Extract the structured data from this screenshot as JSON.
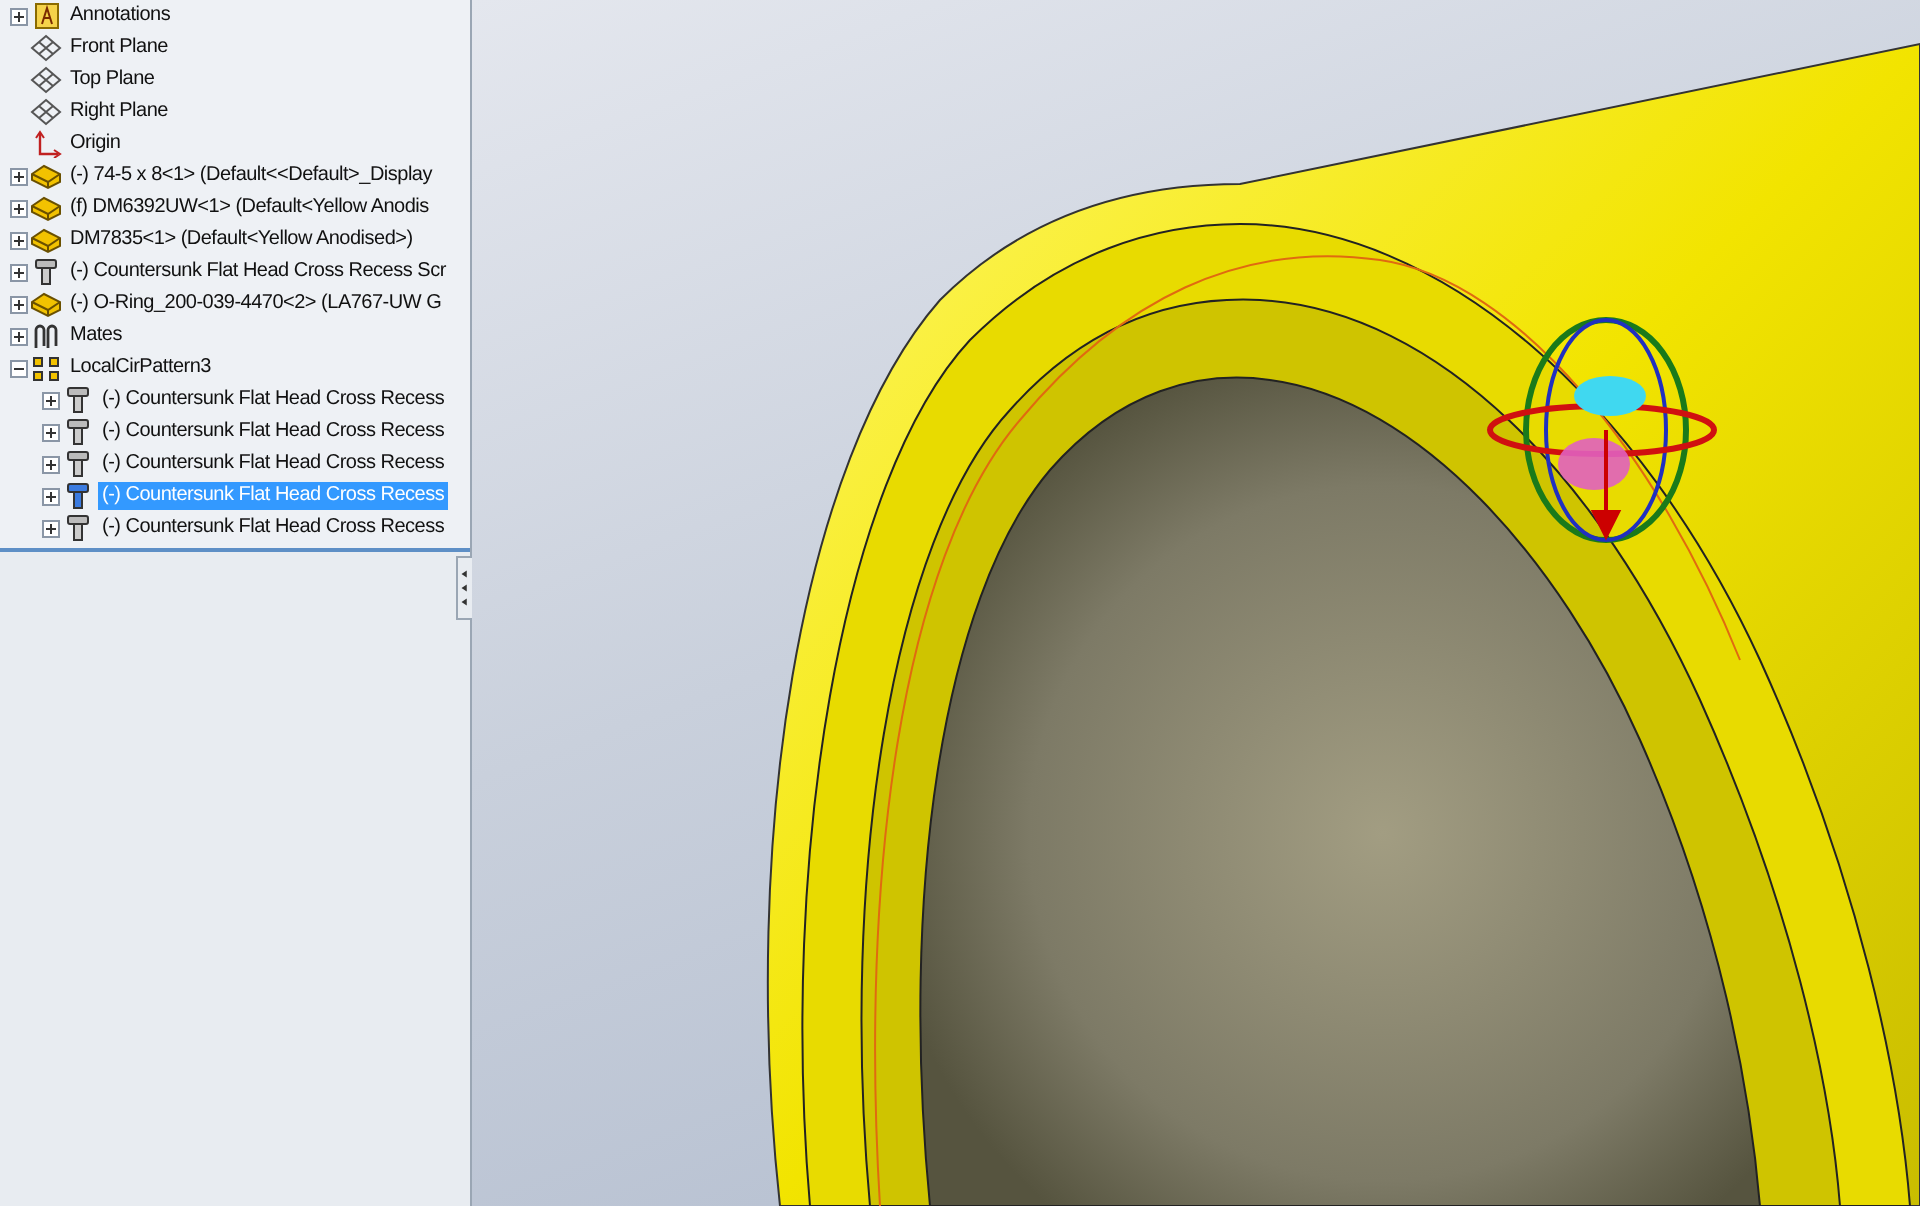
{
  "tree": [
    {
      "kind": "annotations",
      "label": "Annotations",
      "expanded": false,
      "selected": false
    },
    {
      "kind": "plane",
      "label": "Front Plane",
      "selected": false
    },
    {
      "kind": "plane",
      "label": "Top Plane",
      "selected": false
    },
    {
      "kind": "plane",
      "label": "Right Plane",
      "selected": false
    },
    {
      "kind": "origin",
      "label": "Origin",
      "selected": false
    },
    {
      "kind": "part",
      "label": "(-) 74-5 x 8<1> (Default<<Default>_Display",
      "expanded": false,
      "selected": false
    },
    {
      "kind": "part",
      "label": "(f) DM6392UW<1> (Default<Yellow Anodis",
      "expanded": false,
      "selected": false
    },
    {
      "kind": "part",
      "label": "DM7835<1> (Default<Yellow Anodised>)",
      "expanded": false,
      "selected": false
    },
    {
      "kind": "screw",
      "label": "(-) Countersunk Flat Head Cross Recess Scr",
      "expanded": false,
      "selected": false
    },
    {
      "kind": "part",
      "label": "(-) O-Ring_200-039-4470<2> (LA767-UW G",
      "expanded": false,
      "selected": false
    },
    {
      "kind": "mates",
      "label": "Mates",
      "expanded": false,
      "selected": false
    },
    {
      "kind": "pattern",
      "label": "LocalCirPattern3",
      "expanded": true,
      "selected": false,
      "children": [
        {
          "kind": "screw",
          "label": "(-) Countersunk Flat Head Cross Recess",
          "expanded": false,
          "selected": false
        },
        {
          "kind": "screw",
          "label": "(-) Countersunk Flat Head Cross Recess",
          "expanded": false,
          "selected": false
        },
        {
          "kind": "screw",
          "label": "(-) Countersunk Flat Head Cross Recess",
          "expanded": false,
          "selected": false
        },
        {
          "kind": "screw",
          "label": "(-) Countersunk Flat Head Cross Recess",
          "expanded": false,
          "selected": true
        },
        {
          "kind": "screw",
          "label": "(-) Countersunk Flat Head Cross Recess",
          "expanded": false,
          "selected": false
        }
      ]
    }
  ]
}
